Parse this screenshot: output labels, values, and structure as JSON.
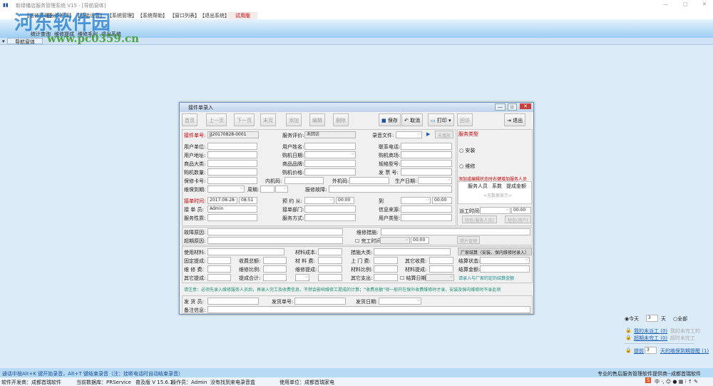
{
  "window": {
    "title": "新绿播店服务管理系统 V15 - [导航窗体]"
  },
  "menu": [
    "【维修管理】",
    "【账务管理】",
    "【基础设置】",
    "【系统管理】",
    "【系统帮助】",
    "【窗口列表】",
    "【退出系统】",
    "试用版"
  ],
  "ribbon": {
    "items": [
      "统计查询",
      "维修提成",
      "维修毛利",
      "退出系统"
    ]
  },
  "tab": {
    "label": "导航窗体"
  },
  "watermark": {
    "name": "河东软件园",
    "url": "www.pc0359.cn"
  },
  "dialog": {
    "title": "接件单录入",
    "toolbar": [
      "首页",
      "上一页",
      "下一页",
      "末页",
      "添加",
      "编辑",
      "删除",
      "保存",
      "取消",
      "打印",
      "回访",
      "退出"
    ],
    "form": {
      "order_no_label": "接件单号:",
      "order_no": "JJ20170828-0001",
      "eval_label": "服务评价:",
      "eval": "未回访",
      "record_label": "录音文件:",
      "play_btn": "未播放",
      "labels_col1": [
        "用户单位:",
        "用户地址:",
        "商品大类:",
        "购机数量:",
        "保修卡号:",
        "维保到期:"
      ],
      "labels_col2": [
        "用户姓名:",
        "购机日期:",
        "商品品牌:",
        "购机价格:",
        "内机码:",
        "周期:"
      ],
      "labels_col3": [
        "联系电话:",
        "购机商场:",
        "规格型号:",
        "发 票 号:",
        "外机码:",
        "报修故障:"
      ],
      "production_date_label": "生产日期:",
      "accept_time_label": "接单时间:",
      "accept_date": "2017-08-28",
      "accept_time": "08:51",
      "appt_from_label": "预 约 从:",
      "appt_from_time": "00:00",
      "appt_to_label": "到",
      "appt_to_time": "00:00",
      "operator_label": "接 单 员:",
      "operator": "Admin",
      "dept_label": "接单部门:",
      "source_label": "信息来源:",
      "nature_label": "服务性质:",
      "mode_label": "服务方式:",
      "user_type_label": "用户类型:",
      "fault_label": "故障原因:",
      "measure_label": "维修措施:",
      "overdue_label": "超期原因:",
      "finish_label": "完工时间",
      "finish_time": "00:00",
      "photo_btn": "照片管理",
      "material_label": "使用材料:",
      "material_cost_label": "材料成本:",
      "measure_cat_label": "措施大类:",
      "fee_labels": [
        [
          "固定提成:",
          "收费总额:",
          "材 料 费:",
          "上 门 费:",
          "其它收费:"
        ],
        [
          "维 修 费:",
          "维修比例:",
          "维修提成:",
          "材料比例:",
          "材料提成:"
        ],
        [
          "其它提成:",
          "提成合计:",
          "",
          "其它支出:",
          "结算日期:"
        ]
      ],
      "note": "请注意：必须先录入维修服务人员后，再录入完工及收费信息，不然会影响维修工提成的计算；“收费总额”项一般只在保外收费维修时才录，安装及保内维修时不录此项",
      "shipper_label": "发 货 员:",
      "ship_no_label": "发货单号:",
      "ship_date_label": "发货日期:",
      "remark_label": "备注信息:"
    },
    "right": {
      "service_type_label": "服务类型",
      "options": [
        "安装",
        "维修"
      ],
      "staff_hint": "添加或编辑状态时右键增加服务人员",
      "staff_cols": [
        "服务人员",
        "系数",
        "提成金额"
      ],
      "empty": "<无数据显示>",
      "dispatch_label": "派工时间:",
      "dispatch_time": "00:00",
      "sms_staff_btn": "短信(服务人员)",
      "sms_user_btn": "短信(用户)",
      "vendor_btn": "厂家结算（安装、保内维修时录入）",
      "settle_status_label": "结算状态:",
      "settle_amount_label": "结算金额:",
      "settle_hint": "请录入与厂家约定的结算金额"
    }
  },
  "side": {
    "today": "今天",
    "days": "3",
    "day_unit": "天",
    "all": "全部",
    "links": [
      [
        "我的未派工 (0)",
        "我的未完工的"
      ],
      [
        "超期未完工 (0)",
        "超时未完工"
      ]
    ],
    "remind_prefix": "提前",
    "remind_days": "3",
    "remind_link": "天的维保到期提醒 (1)"
  },
  "bottom": {
    "hint": "通话中按Alt+K 键开始录音，Alt+T 键结束录音（注：挂断电话时自动结束录音）",
    "slogan": "专业的售后服务管理软件提供商--成都首瑞软件",
    "status": [
      "软件开发商：成都首瑞软件",
      "当前数据库：PRService",
      "普及版 V 15.6.1",
      "操作员：Admin",
      "没有找到来电录音盒",
      "使用单位：成都首瑞家电"
    ]
  }
}
